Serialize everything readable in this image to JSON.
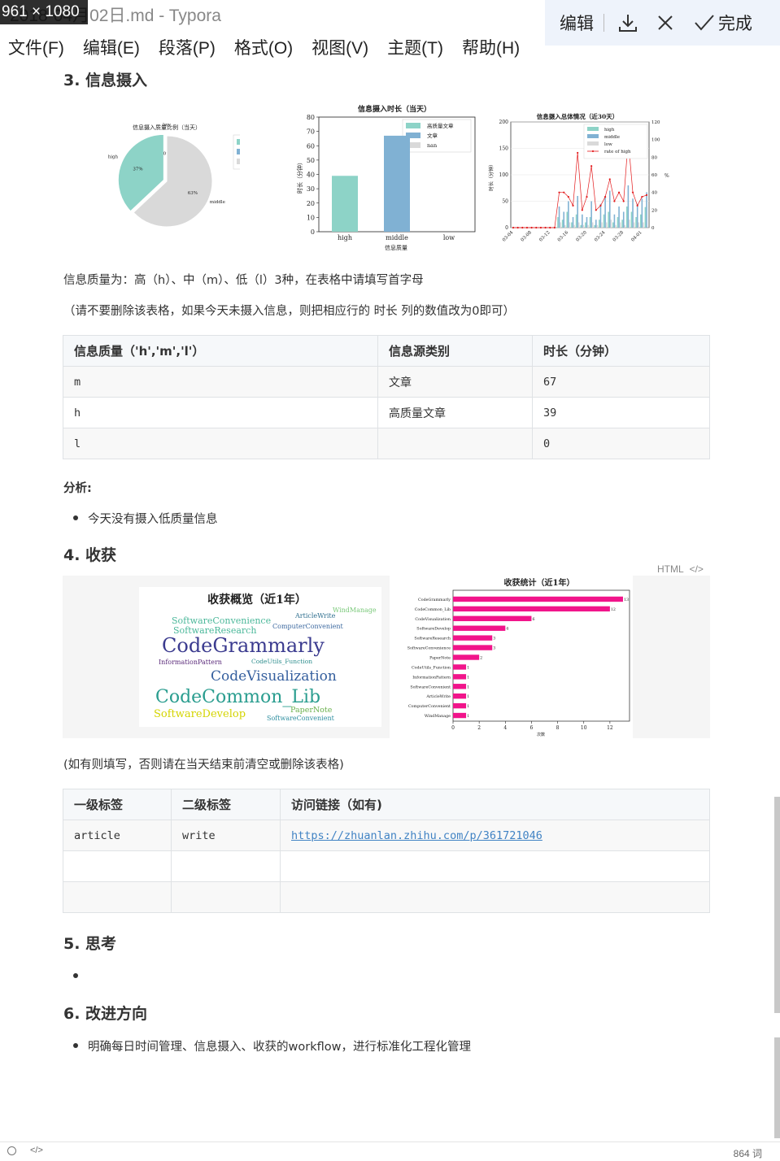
{
  "window": {
    "title": "2018-04月02日.md - Typora",
    "size_badge": "961 × 1080"
  },
  "toolbar": {
    "edit_label": "编辑",
    "done_label": "完成"
  },
  "menu": [
    "文件(F)",
    "编辑(E)",
    "段落(P)",
    "格式(O)",
    "视图(V)",
    "主题(T)",
    "帮助(H)"
  ],
  "section3": {
    "heading": "3. 信息摄入",
    "note1": "信息质量为：高（h）、中（m）、低（l）3种，在表格中请填写首字母",
    "note2": "（请不要删除该表格，如果今天未摄入信息，则把相应行的 时长 列的数值改为0即可）",
    "table": {
      "headers": [
        "信息质量（'h','m','l'）",
        "信息源类别",
        "时长（分钟）"
      ],
      "rows": [
        [
          "m",
          "文章",
          "67"
        ],
        [
          "h",
          "高质量文章",
          "39"
        ],
        [
          "l",
          "",
          "0"
        ]
      ]
    },
    "analysis_label": "分析:",
    "analysis_items": [
      "今天没有摄入低质量信息"
    ]
  },
  "section4": {
    "heading": "4. 收获",
    "html_badge": "HTML",
    "note": "(如有则填写，否则请在当天结束前清空或删除该表格)",
    "table": {
      "headers": [
        "一级标签",
        "二级标签",
        "访问链接（如有)"
      ],
      "rows": [
        [
          "article",
          "write",
          "https://zhuanlan.zhihu.com/p/361721046"
        ],
        [
          "",
          "",
          ""
        ],
        [
          "",
          "",
          ""
        ]
      ]
    },
    "wordcloud": {
      "title": "收获概览（近1年）",
      "words": [
        {
          "text": "CodeGrammarly",
          "color": "#3b3b8f"
        },
        {
          "text": "CodeCommon_Lib",
          "color": "#2a9d8f"
        },
        {
          "text": "CodeVisualization",
          "color": "#355f9e"
        },
        {
          "text": "SoftwareConvenience",
          "color": "#4bb89a"
        },
        {
          "text": "SoftwareResearch",
          "color": "#4bb89a"
        },
        {
          "text": "SoftwareDevelop",
          "color": "#d4d400"
        },
        {
          "text": "ArticleWrite",
          "color": "#2f6f8f"
        },
        {
          "text": "WindManage",
          "color": "#7ac97a"
        },
        {
          "text": "ComputerConvenient",
          "color": "#3e6aa0"
        },
        {
          "text": "InformationPattern",
          "color": "#5a2a7a"
        },
        {
          "text": "CodeUtils_Function",
          "color": "#2f8f8f"
        },
        {
          "text": "PaperNote",
          "color": "#6ab04c"
        },
        {
          "text": "SoftwareConvenient",
          "color": "#2f8fa0"
        }
      ]
    }
  },
  "section5": {
    "heading": "5. 思考",
    "items": [
      ""
    ]
  },
  "section6": {
    "heading": "6. 改进方向",
    "items": [
      "明确每日时间管理、信息摄入、收获的workflow，进行标准化工程化管理"
    ]
  },
  "statusbar": {
    "word_count": "864 词"
  },
  "colors": {
    "high": "#8dd3c7",
    "middle": "#80b1d3",
    "low": "#d9d9d9",
    "rate": "#e31a1c",
    "bars": "#f1148a",
    "link": "#4183c4"
  },
  "chart_data": [
    {
      "type": "pie",
      "title": "信息摄入质量比例（当天）",
      "labels": [
        "high",
        "low",
        "middle"
      ],
      "values": [
        37,
        0,
        63
      ],
      "autopct_labels": [
        "37%",
        "0%",
        "63%"
      ],
      "legend": [
        "high",
        "low",
        "middle"
      ]
    },
    {
      "type": "bar",
      "title": "信息摄入时长（当天）",
      "categories": [
        "high",
        "middle",
        "low"
      ],
      "values": [
        39,
        67,
        0
      ],
      "xlabel": "信息质量",
      "ylabel": "时长（分钟）",
      "ylim": [
        0,
        80
      ],
      "yticks": [
        0,
        10,
        20,
        30,
        40,
        50,
        60,
        70,
        80
      ],
      "legend": [
        "高质量文章",
        "文章",
        "nan"
      ]
    },
    {
      "type": "bar",
      "title": "信息摄入总体情况（近30天）",
      "x_ticks": [
        "03-04",
        "03-08",
        "03-12",
        "03-16",
        "03-20",
        "03-24",
        "03-28",
        "04-01"
      ],
      "ylabel": "时长（分钟）",
      "ylim": [
        0,
        200
      ],
      "yticks": [
        0,
        50,
        100,
        150,
        200
      ],
      "y2lim": [
        0,
        120
      ],
      "y2ticks": [
        0,
        20,
        40,
        60,
        80,
        100,
        120
      ],
      "y2label": "%",
      "legend": [
        "high",
        "middle",
        "low",
        "rate of high"
      ],
      "series": [
        {
          "name": "high",
          "values": [
            0,
            0,
            0,
            0,
            0,
            0,
            0,
            0,
            0,
            0,
            20,
            15,
            30,
            10,
            25,
            5,
            10,
            20,
            5,
            15,
            25,
            30,
            10,
            20,
            15,
            40,
            30,
            20,
            25,
            39
          ]
        },
        {
          "name": "middle",
          "values": [
            0,
            0,
            0,
            0,
            0,
            0,
            0,
            0,
            0,
            0,
            40,
            30,
            50,
            20,
            60,
            25,
            20,
            50,
            15,
            45,
            60,
            70,
            25,
            40,
            30,
            80,
            55,
            45,
            55,
            67
          ]
        },
        {
          "name": "low",
          "values": [
            0,
            0,
            0,
            0,
            0,
            0,
            0,
            0,
            0,
            0,
            10,
            5,
            10,
            5,
            10,
            5,
            5,
            10,
            5,
            10,
            10,
            15,
            5,
            10,
            5,
            15,
            10,
            10,
            10,
            0
          ]
        },
        {
          "name": "rate of high",
          "values": [
            0,
            0,
            0,
            0,
            0,
            0,
            0,
            0,
            0,
            0,
            40,
            40,
            35,
            25,
            85,
            20,
            35,
            70,
            20,
            25,
            35,
            55,
            30,
            40,
            30,
            100,
            40,
            25,
            35,
            37
          ]
        }
      ]
    },
    {
      "type": "bar",
      "orientation": "horizontal",
      "title": "收获统计（近1年）",
      "xlabel": "次数",
      "xlim": [
        0,
        13.5
      ],
      "xticks": [
        0,
        2,
        4,
        6,
        8,
        10,
        12
      ],
      "categories": [
        "CodeGrammarly",
        "CodeCommon_Lib",
        "CodeVisualization",
        "SoftwareDevelop",
        "SoftwareResearch",
        "SoftwareConvenience",
        "PaperNote",
        "CodeUtils_Function",
        "InformationPattern",
        "SoftwareConvenient",
        "ArticleWrite",
        "ComputerConvenient",
        "WindManage"
      ],
      "values": [
        13,
        12,
        6,
        4,
        3,
        3,
        2,
        1,
        1,
        1,
        1,
        1,
        1
      ]
    }
  ]
}
